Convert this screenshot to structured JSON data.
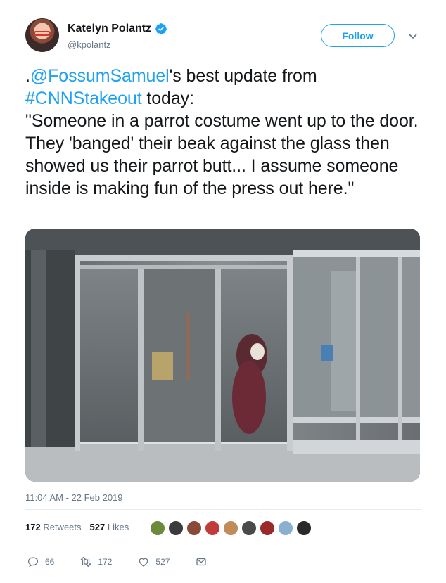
{
  "user": {
    "display_name": "Katelyn Polantz",
    "handle": "@kpolantz",
    "verified": true,
    "avatar_icon": "profile-avatar"
  },
  "follow_button": {
    "label": "Follow"
  },
  "tweet": {
    "prefix": ".",
    "mention": "@FossumSamuel",
    "text_1": "'s best update from",
    "hashtag": "#CNNStakeout",
    "text_2": " today:",
    "quote": "\"Someone in a parrot costume went up to the door. They 'banged' their beak against the glass then showed us their parrot butt... I assume someone inside is making fun of the press out here.\""
  },
  "timestamp": "11:04 AM - 22 Feb 2019",
  "stats": {
    "retweets_count": "172",
    "retweets_label": "Retweets",
    "likes_count": "527",
    "likes_label": "Likes"
  },
  "actions": {
    "reply_count": "66",
    "retweet_count": "172",
    "like_count": "527"
  },
  "colors": {
    "accent": "#1da1f2",
    "text": "#14171a",
    "muted": "#657786",
    "border": "#e6ecf0"
  }
}
